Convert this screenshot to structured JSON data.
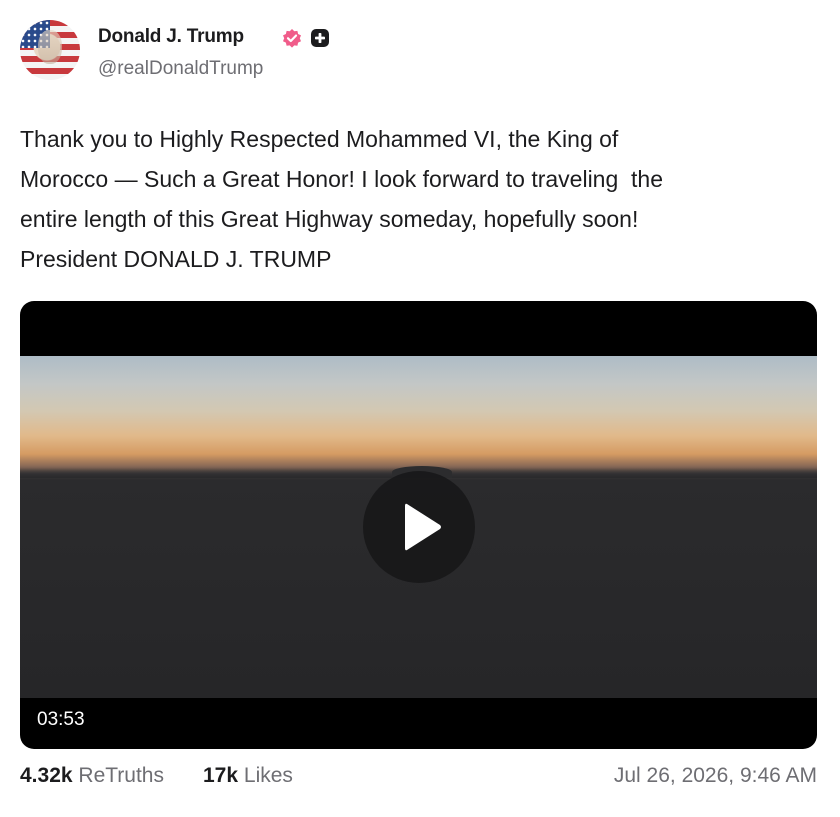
{
  "author": {
    "name": "Donald J. Trump",
    "handle": "@realDonaldTrump",
    "verified_badge_icon": "verified-badge-icon",
    "verified_color": "#f05c8a",
    "plus_badge_icon": "plus-badge-icon"
  },
  "post": {
    "text": "Thank you to Highly Respected Mohammed VI, the King of\nMorocco — Such a Great Honor! I look forward to traveling  the\nentire length of this Great Highway someday, hopefully soon!\nPresident DONALD J. TRUMP"
  },
  "video": {
    "duration": "03:53",
    "play_icon": "play-icon"
  },
  "stats": {
    "retruths_count": "4.32k",
    "retruths_label": "ReTruths",
    "likes_count": "17k",
    "likes_label": "Likes",
    "timestamp": "Jul 26, 2026, 9:46 AM"
  }
}
